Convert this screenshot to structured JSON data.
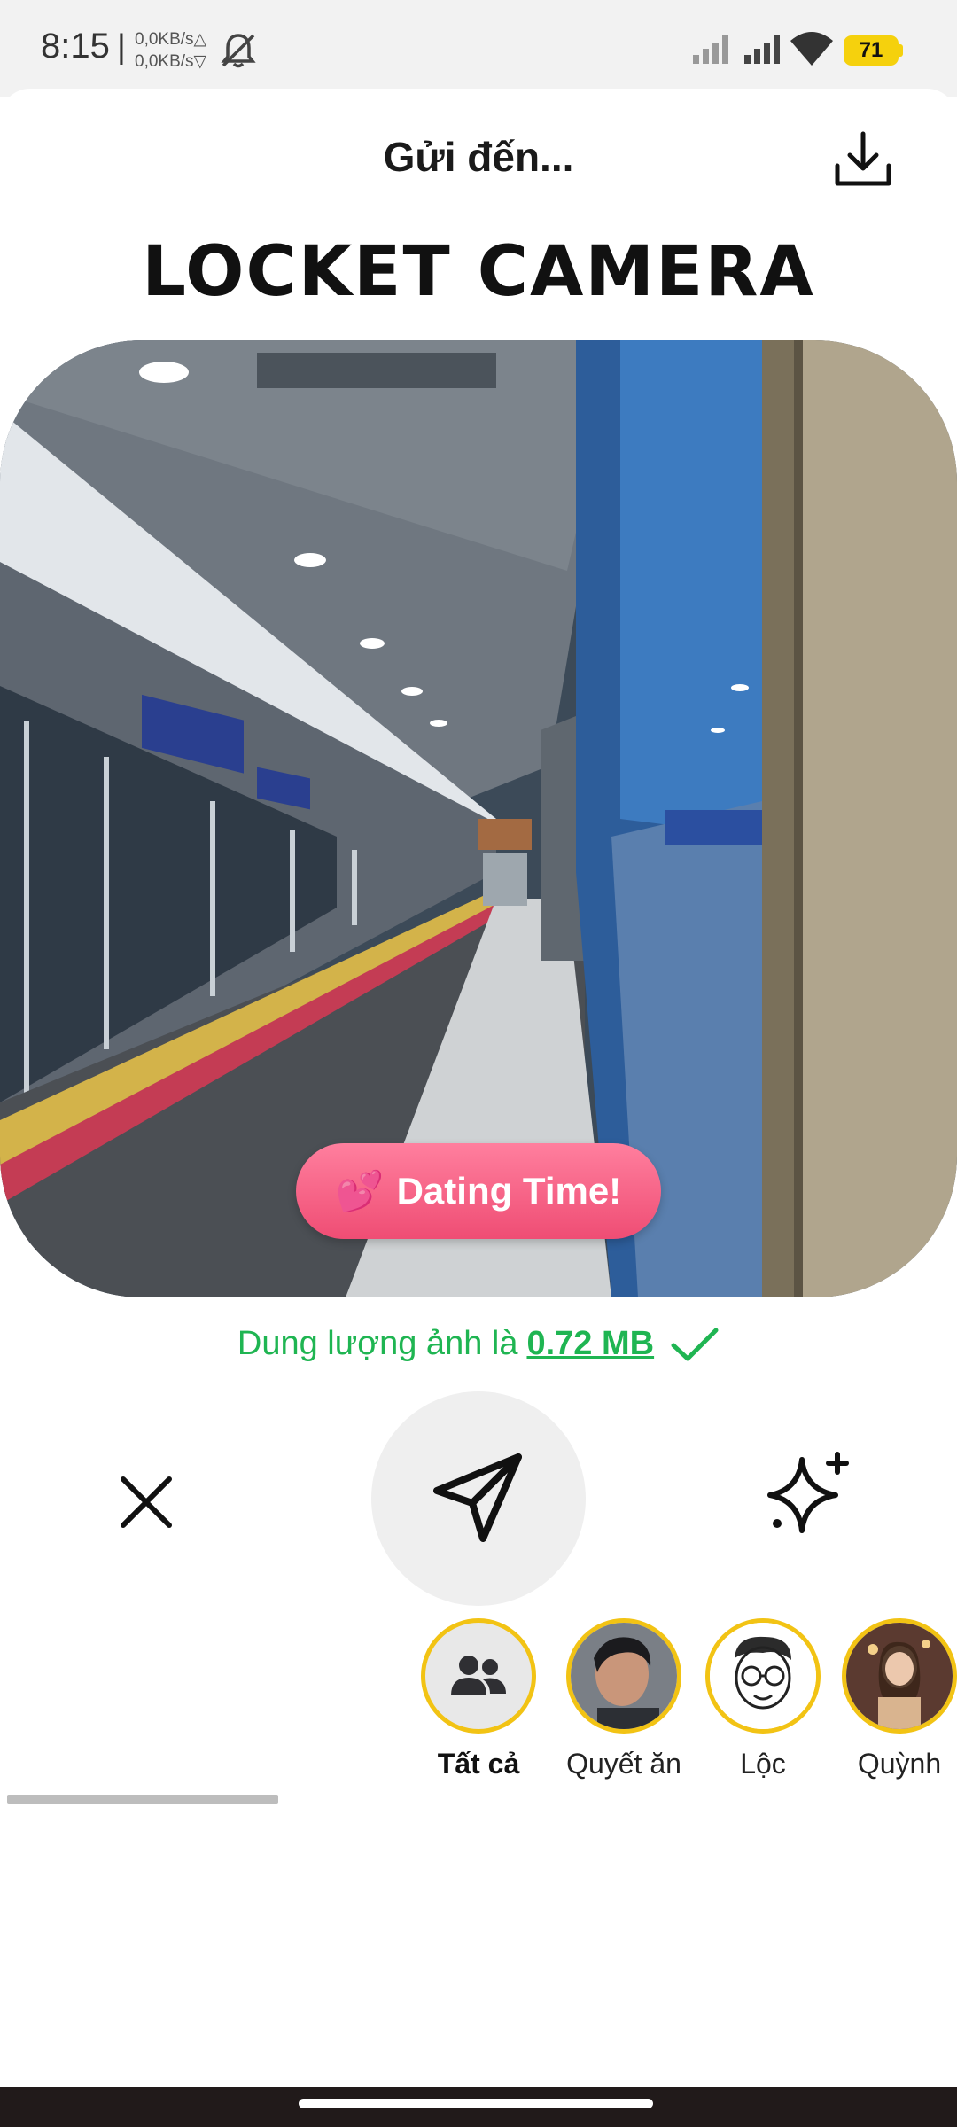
{
  "status_bar": {
    "time": "8:15",
    "separator": "|",
    "net_up": "0,0KB/s△",
    "net_down": "0,0KB/s▽",
    "battery": "71",
    "icons": [
      "mute-icon",
      "signal-icon",
      "signal-icon",
      "wifi-icon",
      "battery-icon"
    ],
    "battery_color": "#f5d10d"
  },
  "header": {
    "title": "Gửi đến...",
    "download_icon": "download-icon",
    "brand": "LOCKET CAMERA"
  },
  "photo": {
    "caption_icon": "💕",
    "caption": "Dating Time!",
    "caption_color": "#f25a7e"
  },
  "size_note": {
    "prefix": "Dung lượng ảnh là",
    "value": "0.72 MB",
    "color": "#1fb552",
    "icon": "check-icon"
  },
  "actions": {
    "close_icon": "close-icon",
    "send_icon": "send-icon",
    "sparkle_icon": "sparkle-icon"
  },
  "recipients": [
    {
      "name": "Tất cả",
      "icon": "group-icon",
      "selected": true
    },
    {
      "name": "Quyết ăn",
      "icon": "avatar"
    },
    {
      "name": "Lộc",
      "icon": "avatar"
    },
    {
      "name": "Quỳnh",
      "icon": "avatar"
    }
  ],
  "accent_color": "#f2c314"
}
